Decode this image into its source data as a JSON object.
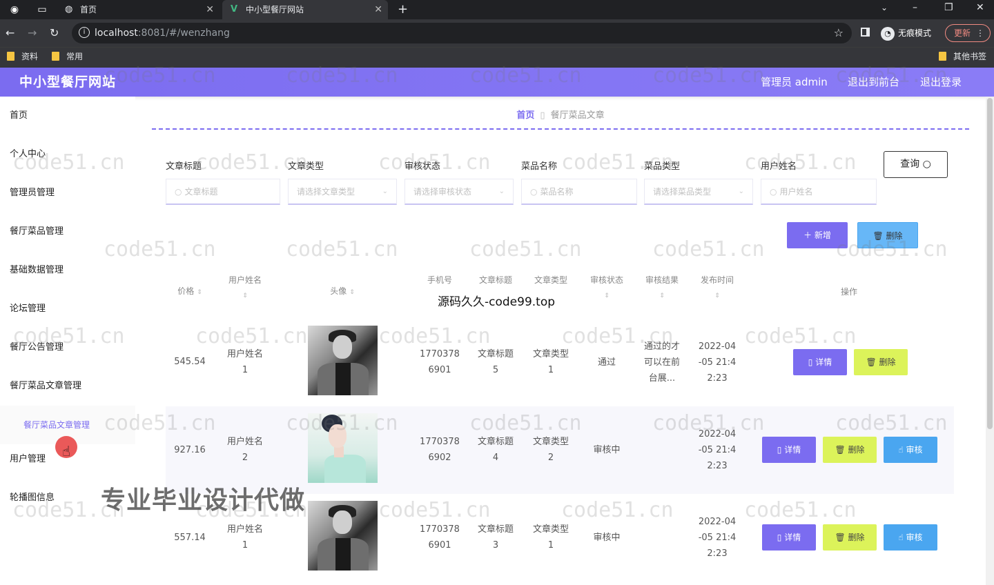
{
  "browser": {
    "tabs": [
      {
        "title": "首页"
      },
      {
        "title": "中小型餐厅网站"
      }
    ],
    "url_host": "localhost",
    "url_rest": ":8081/#/wenzhang",
    "profile_label": "无痕模式",
    "update_label": "更新",
    "bookmarks": [
      "资料",
      "常用"
    ],
    "other_bookmarks": "其他书签"
  },
  "header": {
    "title": "中小型餐厅网站",
    "admin_label": "管理员 admin",
    "back_label": "退出到前台",
    "logout_label": "退出登录"
  },
  "sidebar": {
    "items": [
      "首页",
      "个人中心",
      "管理员管理",
      "餐厅菜品管理",
      "基础数据管理",
      "论坛管理",
      "餐厅公告管理",
      "餐厅菜品文章管理",
      "餐厅菜品文章管理",
      "用户管理",
      "轮播图信息"
    ]
  },
  "breadcrumb": {
    "home": "首页",
    "current": "餐厅菜品文章"
  },
  "filters": [
    {
      "label": "文章标题",
      "placeholder": "文章标题"
    },
    {
      "label": "文章类型",
      "placeholder": "请选择文章类型"
    },
    {
      "label": "审核状态",
      "placeholder": "请选择审核状态"
    },
    {
      "label": "菜品名称",
      "placeholder": "菜品名称"
    },
    {
      "label": "菜品类型",
      "placeholder": "请选择菜品类型"
    },
    {
      "label": "用户姓名",
      "placeholder": "用户姓名"
    }
  ],
  "actions": {
    "query": "查询",
    "add": "新增",
    "delete": "删除"
  },
  "table": {
    "headers": {
      "price": "价格",
      "username": "用户姓名",
      "avatar": "头像",
      "phone": "手机号",
      "article_title": "文章标题",
      "article_type": "文章类型",
      "review_status": "审核状态",
      "review_result": "审核结果",
      "publish_time": "发布时间",
      "operation": "操作"
    },
    "buttons": {
      "detail": "详情",
      "delete": "删除",
      "review": "审核"
    },
    "rows": [
      {
        "price": "545.54",
        "username": [
          "用户姓名",
          "1"
        ],
        "phone": [
          "1770378",
          "6901"
        ],
        "title": [
          "文章标题",
          "5"
        ],
        "type": [
          "文章类型",
          "1"
        ],
        "status": "通过",
        "result": [
          "通过的才",
          "可以在前",
          "台展..."
        ],
        "time": [
          "2022-04",
          "-05 21:4",
          "2:23"
        ]
      },
      {
        "price": "927.16",
        "username": [
          "用户姓名",
          "2"
        ],
        "phone": [
          "1770378",
          "6902"
        ],
        "title": [
          "文章标题",
          "4"
        ],
        "type": [
          "文章类型",
          "2"
        ],
        "status": "审核中",
        "result": [
          "",
          "",
          ""
        ],
        "time": [
          "2022-04",
          "-05 21:4",
          "2:23"
        ]
      },
      {
        "price": "557.14",
        "username": [
          "用户姓名",
          "1"
        ],
        "phone": [
          "1770378",
          "6901"
        ],
        "title": [
          "文章标题",
          "3"
        ],
        "type": [
          "文章类型",
          "1"
        ],
        "status": "审核中",
        "result": [
          "",
          "",
          ""
        ],
        "time": [
          "2022-04",
          "-05 21:4",
          "2:23"
        ]
      }
    ]
  },
  "overlays": {
    "watermark": "code51.cn",
    "source_text": "源码久久-code99.top",
    "promo_text": "专业毕业设计代做"
  }
}
